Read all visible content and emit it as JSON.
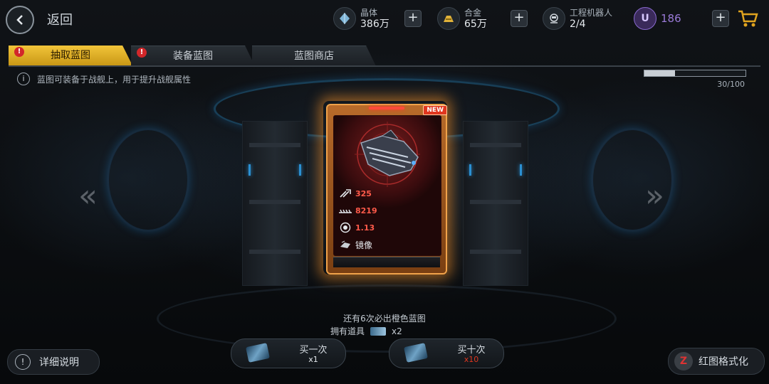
{
  "header": {
    "back_label": "返回",
    "resources": [
      {
        "label": "晶体",
        "value": "386万"
      },
      {
        "label": "合金",
        "value": "65万"
      },
      {
        "label": "工程机器人",
        "value": "2/4"
      }
    ],
    "premium_value": "186",
    "premium_icon_glyph": "U"
  },
  "tabs": [
    {
      "label": "抽取蓝图",
      "badge": "!",
      "active": true
    },
    {
      "label": "装备蓝图",
      "badge": "!",
      "active": false
    },
    {
      "label": "蓝图商店",
      "active": false
    }
  ],
  "info_text": "蓝图可装备于战舰上，用于提升战舰属性",
  "info_icon": "i",
  "progress": {
    "text": "30/100",
    "fraction": 0.3
  },
  "card": {
    "new_tag": "NEW",
    "stats": [
      {
        "icon": "attack-icon",
        "value": "325"
      },
      {
        "icon": "hull-icon",
        "value": "8219"
      },
      {
        "icon": "speed-icon",
        "value": "1.13"
      }
    ],
    "skill_name": "镜像"
  },
  "nav": {
    "left_arrow": "«",
    "right_arrow": "»"
  },
  "bottom": {
    "hint_pity": "还有6次必出橙色蓝图",
    "own_items_label": "拥有道具",
    "own_items_count": "x2",
    "buy_one": {
      "label": "买一次",
      "count": "x1"
    },
    "buy_ten": {
      "label": "买十次",
      "count": "x10"
    },
    "detail_label": "详细说明",
    "detail_icon": "!",
    "format_label": "红图格式化",
    "format_icon": "Z"
  },
  "colors": {
    "accent_gold": "#f2c53a",
    "count_white": "#e5e9ed",
    "count_red": "#e0361f"
  }
}
